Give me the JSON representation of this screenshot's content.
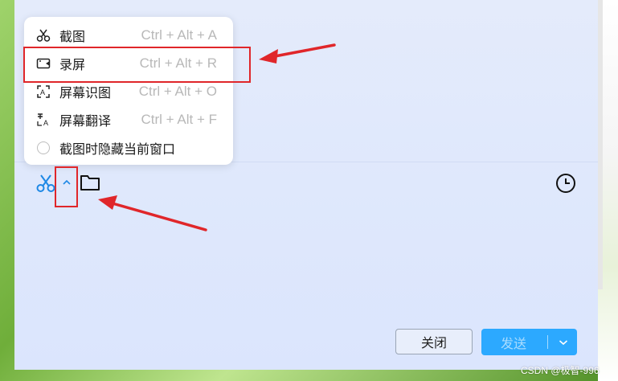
{
  "menu": {
    "items": [
      {
        "label": "截图",
        "shortcut": "Ctrl + Alt + A",
        "icon": "scissors-icon"
      },
      {
        "label": "录屏",
        "shortcut": "Ctrl + Alt + R",
        "icon": "screen-record-icon"
      },
      {
        "label": "屏幕识图",
        "shortcut": "Ctrl + Alt + O",
        "icon": "screen-recognize-icon"
      },
      {
        "label": "屏幕翻译",
        "shortcut": "Ctrl + Alt + F",
        "icon": "screen-translate-icon"
      },
      {
        "label": "截图时隐藏当前窗口",
        "shortcut": "",
        "icon": "radio-icon"
      }
    ]
  },
  "toolbar": {
    "screenshot_icon": "scissors-icon",
    "expand_icon": "chevron-up-icon",
    "folder_icon": "folder-icon",
    "history_icon": "clock-icon"
  },
  "buttons": {
    "close_label": "关闭",
    "send_label": "发送"
  },
  "watermark": "CSDN @极智-996",
  "colors": {
    "accent": "#2ca9ff",
    "annotation": "#e0262a",
    "icon_blue": "#1e88e5"
  }
}
